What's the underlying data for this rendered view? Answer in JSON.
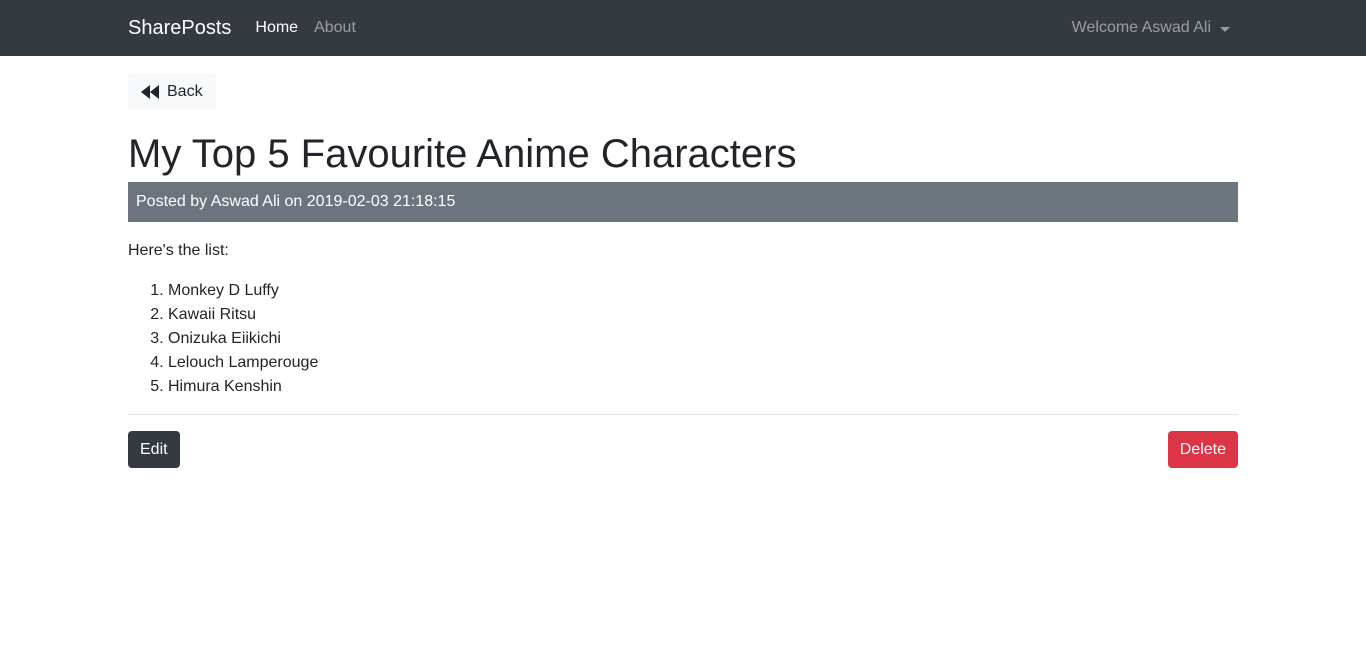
{
  "navbar": {
    "brand": "SharePosts",
    "links": [
      {
        "label": "Home"
      },
      {
        "label": "About"
      }
    ],
    "user_menu": "Welcome Aswad Ali"
  },
  "colors": {
    "navbar_bg": "#343a40",
    "meta_bg": "#6c757d",
    "edit_bg": "#343a40",
    "delete_bg": "#dc3545"
  },
  "post": {
    "back_label": "Back",
    "title": "My Top 5 Favourite Anime Characters",
    "meta": "Posted by Aswad Ali on 2019-02-03 21:18:15",
    "intro": "Here's the list:",
    "list": [
      "Monkey D Luffy",
      "Kawaii Ritsu",
      "Onizuka Eiikichi",
      "Lelouch Lamperouge",
      "Himura Kenshin"
    ],
    "edit_label": "Edit",
    "delete_label": "Delete"
  }
}
